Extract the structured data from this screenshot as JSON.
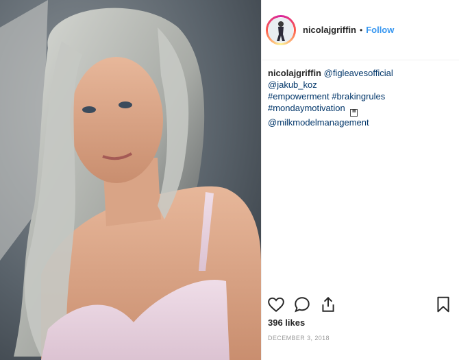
{
  "post": {
    "username": "nicolajgriffin",
    "separator": "•",
    "follow_label": "Follow",
    "caption": {
      "author": "nicolajgriffin",
      "mention1": "@figleavesofficial",
      "mention2": "@jakub_koz",
      "tags1": "#empowerment #brakingrules",
      "tags2": "#mondaymotivation",
      "mention3": "@milkmodelmanagement"
    },
    "likes": "396 likes",
    "date": "DECEMBER 3, 2018"
  },
  "icons": {
    "like": "heart-icon",
    "comment": "comment-icon",
    "share": "share-icon",
    "save": "bookmark-icon"
  },
  "colors": {
    "follow": "#3897f0",
    "link": "#003569",
    "date": "#999999"
  }
}
